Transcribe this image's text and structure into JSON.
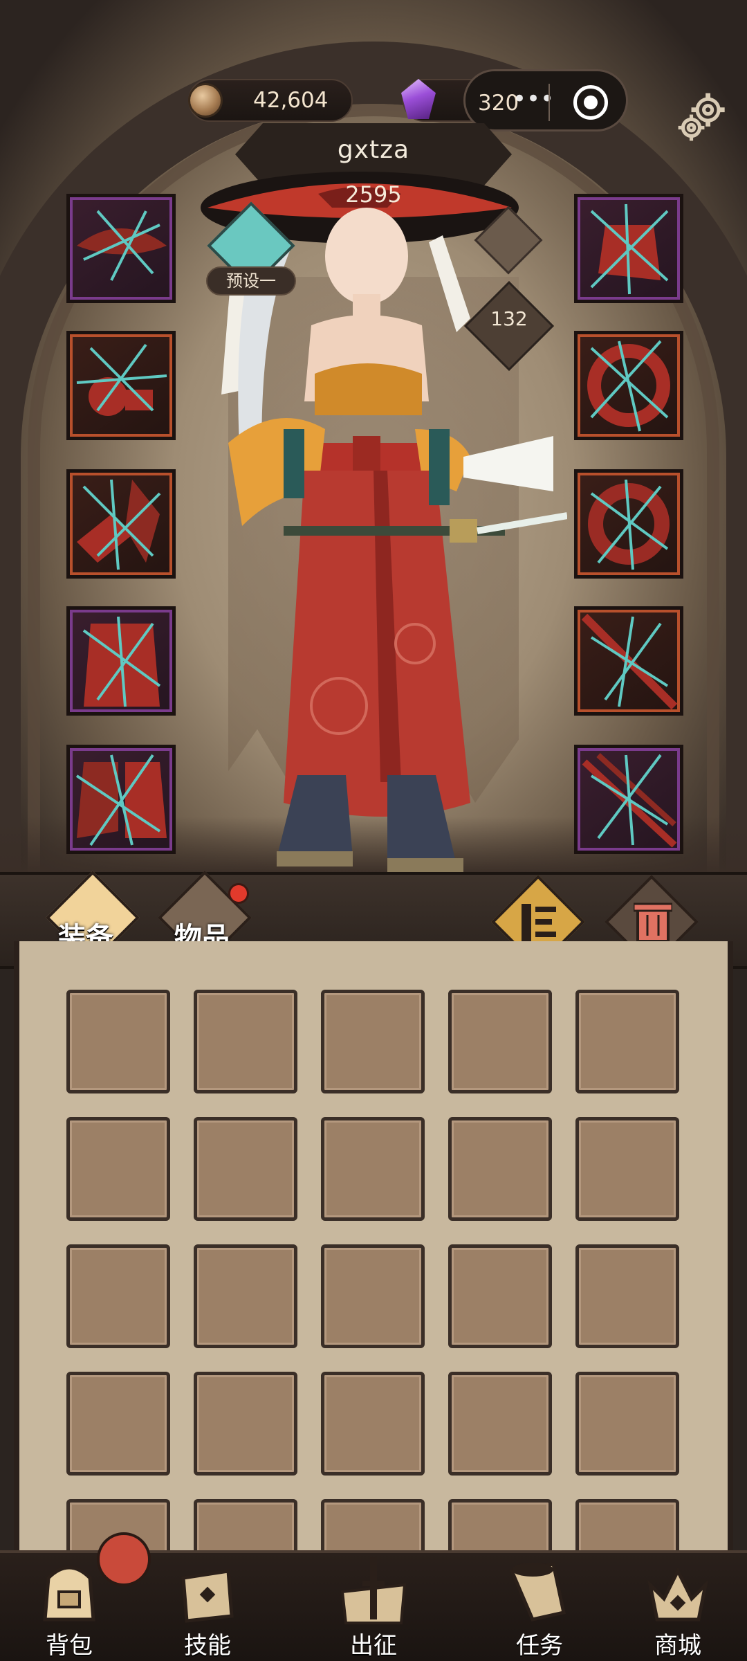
{
  "header": {
    "coins": "42,604",
    "gems": "320",
    "capsule_dots": "•••"
  },
  "player": {
    "name": "gxtza",
    "power": "2595",
    "preset_label": "预设一",
    "level": "132"
  },
  "tabs": {
    "equipment_label": "装备",
    "items_label": "物品"
  },
  "equipment_slots": {
    "left": [
      "hat-slot",
      "necklace-slot",
      "armor-slot",
      "belt-slot",
      "boots-slot"
    ],
    "right": [
      "cape-slot",
      "ring-slot",
      "ring-2-slot",
      "weapon-slot",
      "bow-slot"
    ]
  },
  "inventory": {
    "rows": 5,
    "cols": 5
  },
  "bottom_nav": {
    "items": [
      {
        "label": "背包",
        "icon": "backpack-icon"
      },
      {
        "label": "技能",
        "icon": "skill-book-icon"
      },
      {
        "label": "出征",
        "icon": "expedition-sword-icon"
      },
      {
        "label": "任务",
        "icon": "quest-horn-icon"
      },
      {
        "label": "商城",
        "icon": "shop-crown-icon"
      }
    ]
  },
  "colors": {
    "slot_purple": "#7a3b8c",
    "slot_orange": "#b8502c",
    "badge_red": "#e23a2c",
    "preset_teal": "#6ac8c0",
    "parchment": "#c8b89e"
  }
}
